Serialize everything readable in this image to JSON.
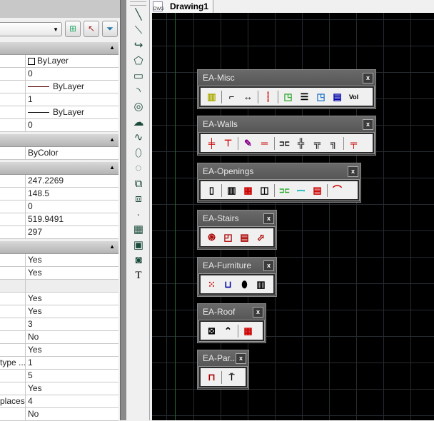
{
  "properties": {
    "sections": [
      {
        "rows": [
          {
            "key": "",
            "value": "ByLayer",
            "kind": "check"
          },
          {
            "key": "",
            "value": "0"
          },
          {
            "key": "",
            "value": "ByLayer",
            "kind": "line"
          },
          {
            "key": "",
            "value": "1"
          },
          {
            "key": "",
            "value": "ByLayer",
            "kind": "lineblk"
          },
          {
            "key": "",
            "value": "0"
          }
        ]
      },
      {
        "rows": [
          {
            "key": "",
            "value": "ByColor"
          }
        ]
      },
      {
        "rows": [
          {
            "key": "",
            "value": "247.2269"
          },
          {
            "key": "",
            "value": "148.5"
          },
          {
            "key": "",
            "value": "0"
          },
          {
            "key": "",
            "value": "519.9491"
          },
          {
            "key": "",
            "value": "297"
          }
        ]
      },
      {
        "rows": [
          {
            "key": "",
            "value": "Yes"
          },
          {
            "key": "",
            "value": "Yes"
          },
          {
            "key": "",
            "value": "",
            "kind": "gray"
          },
          {
            "key": "",
            "value": "Yes"
          },
          {
            "key": "",
            "value": "Yes"
          },
          {
            "key": "",
            "value": "3"
          },
          {
            "key": "",
            "value": "No"
          },
          {
            "key": "",
            "value": "Yes"
          },
          {
            "key": "type ...",
            "value": "1"
          },
          {
            "key": "",
            "value": "5"
          },
          {
            "key": "",
            "value": "Yes"
          },
          {
            "key": "places",
            "value": "4"
          },
          {
            "key": "",
            "value": "No"
          }
        ]
      }
    ]
  },
  "draw_tools": [
    "line",
    "construction-line",
    "polyline",
    "polygon",
    "rectangle",
    "arc",
    "circle",
    "revision-cloud",
    "spline",
    "ellipse",
    "ellipse-arc",
    "insert-block",
    "make-block",
    "point",
    "hatch",
    "gradient",
    "region",
    "multiline-text"
  ],
  "tab": {
    "label": "Drawing1",
    "icon_label": "DWG"
  },
  "palettes": [
    {
      "title": "EA-Misc",
      "icons": [
        "room",
        "|",
        "rectangle-area",
        "dimension",
        "|",
        "centerline",
        "|",
        "tag-green",
        "schedule",
        "tag-blue",
        "table",
        "Vol"
      ]
    },
    {
      "title": "EA-Walls",
      "icons": [
        "wall-add",
        "wall-offset",
        "|",
        "wall-brush",
        "wall-join",
        "|",
        "wall-break",
        "wall-cross",
        "wall-tee",
        "wall-corner",
        "|",
        "wall-multi"
      ]
    },
    {
      "title": "EA-Openings",
      "icons": [
        "door",
        "|",
        "window",
        "window-grid",
        "window-split",
        "|",
        "opening",
        "opening-cyan",
        "shutter",
        "|",
        "arc-opening"
      ]
    },
    {
      "title": "EA-Stairs",
      "icons": [
        "spiral-stair",
        "l-stair",
        "straight-stair",
        "angle-stair"
      ]
    },
    {
      "title": "EA-Furniture",
      "icons": [
        "stove",
        "sofa",
        "toilet",
        "radiator"
      ]
    },
    {
      "title": "EA-Roof",
      "icons": [
        "roof-plan",
        "roof-gable",
        "|",
        "rafters"
      ]
    },
    {
      "title": "EA-Par...",
      "icons": [
        "param-block",
        "|",
        "param-stretch"
      ]
    }
  ],
  "close_label": "x"
}
